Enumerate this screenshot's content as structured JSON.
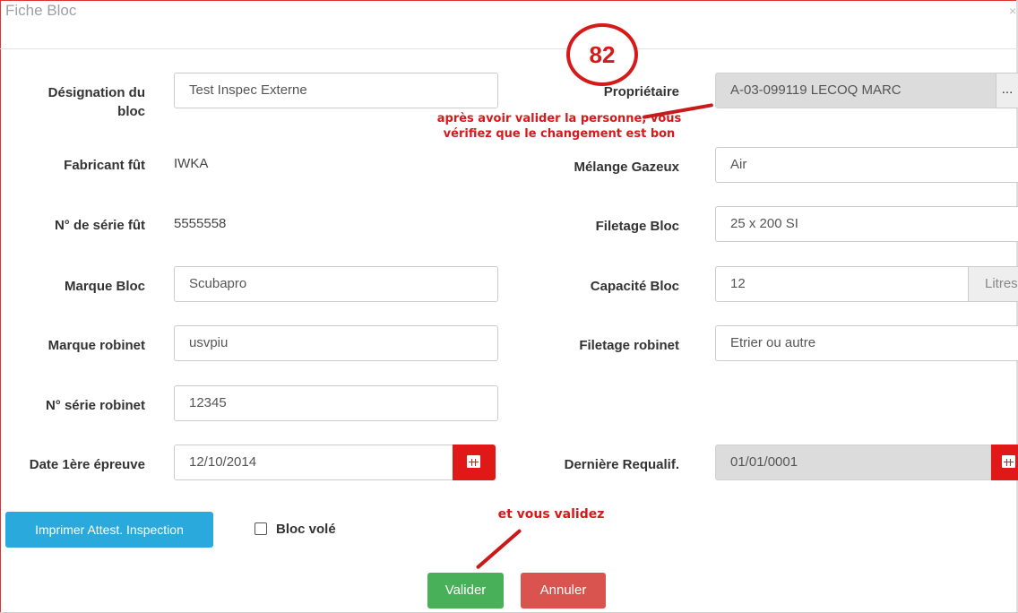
{
  "modal": {
    "title": "Fiche Bloc",
    "close": "×"
  },
  "left": {
    "designation": {
      "label_1": "Désignation du",
      "label_2": "bloc",
      "value": "Test Inspec Externe"
    },
    "fabricant": {
      "label": "Fabricant fût",
      "value": "IWKA"
    },
    "serie_fut": {
      "label": "N° de série fût",
      "value": "5555558"
    },
    "marque_bloc": {
      "label": "Marque Bloc",
      "value": "Scubapro"
    },
    "marque_robinet": {
      "label": "Marque robinet",
      "value": "usvpiu"
    },
    "serie_robinet": {
      "label": "N° série robinet",
      "value": "12345"
    },
    "date_epreuve": {
      "label": "Date 1ère épreuve",
      "value": "12/10/2014"
    }
  },
  "right": {
    "proprietaire": {
      "label": "Propriétaire",
      "value": "A-03-099119 LECOQ MARC",
      "button": "..."
    },
    "melange": {
      "label": "Mélange Gazeux",
      "value": "Air"
    },
    "filetage_bloc": {
      "label": "Filetage Bloc",
      "value": "25 x 200 SI"
    },
    "capacite": {
      "label": "Capacité Bloc",
      "value": "12",
      "unit": "Litres"
    },
    "filetage_robinet": {
      "label": "Filetage robinet",
      "value": "Etrier ou autre"
    },
    "requalif": {
      "label": "Dernière Requalif.",
      "value": "01/01/0001"
    }
  },
  "actions": {
    "print": "Imprimer Attest. Inspection",
    "stolen": "Bloc volé",
    "validate": "Valider",
    "cancel": "Annuler"
  },
  "annotations": {
    "step": "82",
    "note_1": "après avoir valider la personne, vous",
    "note_2": "vérifiez que le changement est bon",
    "note_3": "et vous validez"
  },
  "colors": {
    "primary": "#29a9dc",
    "success": "#49b05a",
    "danger": "#d9534f",
    "calendar": "#e01818",
    "annotation": "#d41a1a"
  }
}
